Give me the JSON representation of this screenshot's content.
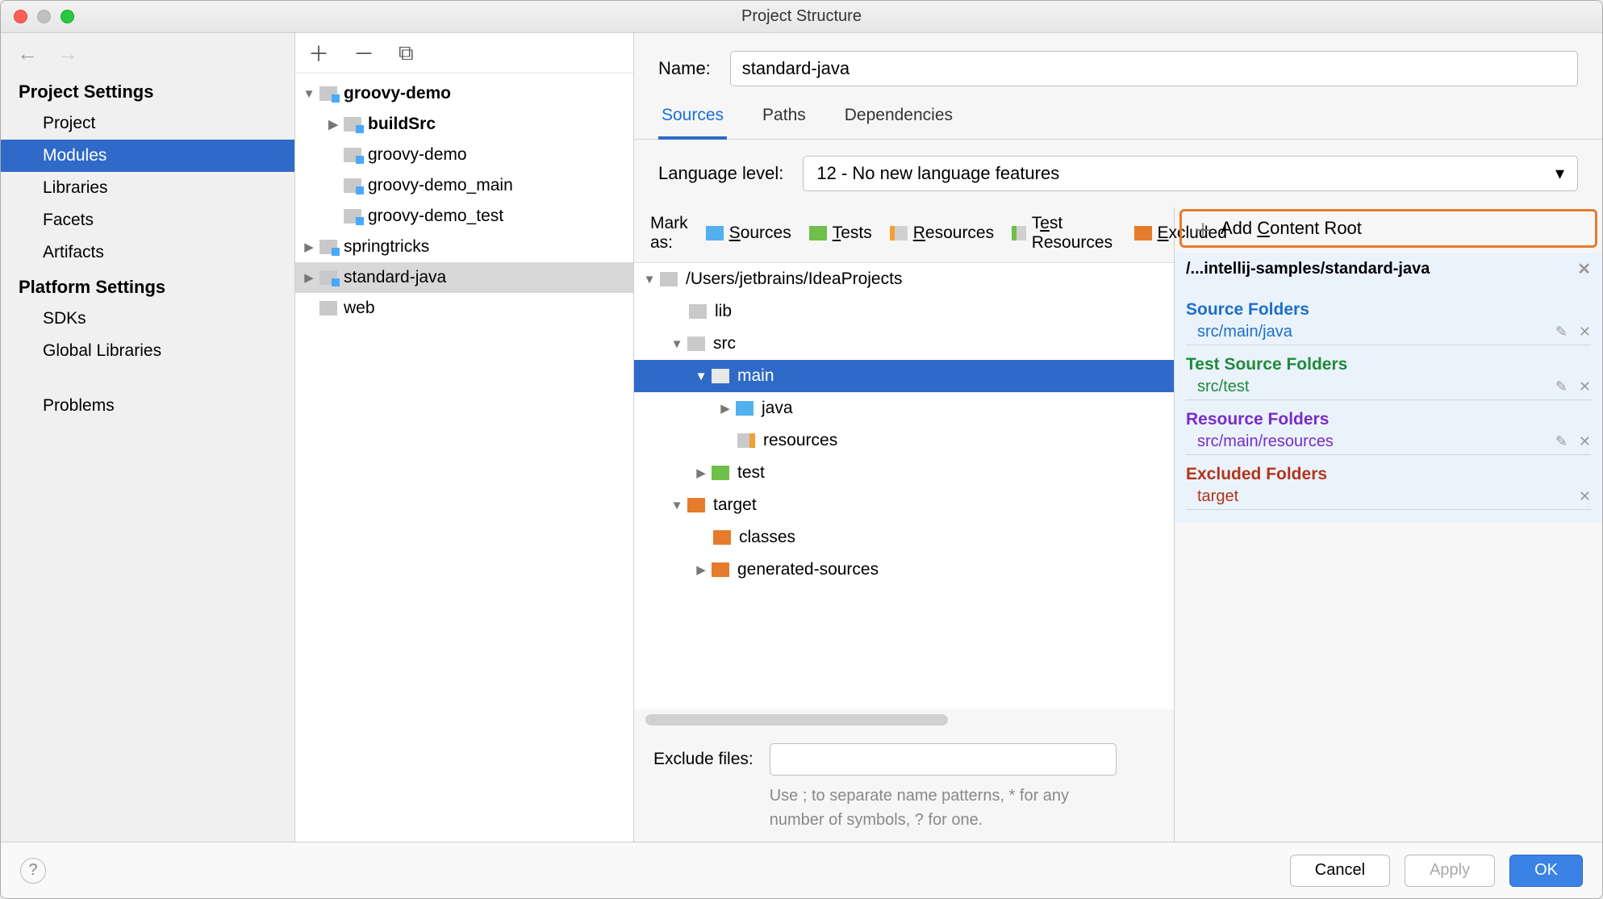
{
  "window": {
    "title": "Project Structure"
  },
  "sidebar": {
    "sections": {
      "project_settings": "Project Settings",
      "platform_settings": "Platform Settings"
    },
    "items": {
      "project": "Project",
      "modules": "Modules",
      "libraries": "Libraries",
      "facets": "Facets",
      "artifacts": "Artifacts",
      "sdks": "SDKs",
      "global_libraries": "Global Libraries",
      "problems": "Problems"
    }
  },
  "module_tree": {
    "groovy_demo": "groovy-demo",
    "buildSrc": "buildSrc",
    "groovy_demo_mod": "groovy-demo",
    "groovy_demo_main": "groovy-demo_main",
    "groovy_demo_test": "groovy-demo_test",
    "springtricks": "springtricks",
    "standard_java": "standard-java",
    "web": "web"
  },
  "main": {
    "name_label": "Name:",
    "name_value": "standard-java",
    "tabs": {
      "sources": "Sources",
      "paths": "Paths",
      "dependencies": "Dependencies"
    },
    "lang_label": "Language level:",
    "lang_value": "12 - No new language features",
    "markas_label": "Mark as:",
    "marks": {
      "sources": "Sources",
      "tests": "Tests",
      "resources": "Resources",
      "test_resources": "Test Resources",
      "excluded": "Excluded"
    },
    "src_tree": {
      "root": "/Users/jetbrains/IdeaProjects",
      "lib": "lib",
      "src": "src",
      "main": "main",
      "java": "java",
      "resources": "resources",
      "test": "test",
      "target": "target",
      "classes": "classes",
      "generated_sources": "generated-sources"
    },
    "exclude_label": "Exclude files:",
    "exclude_hint": "Use ; to separate name patterns, * for any number of symbols, ? for one."
  },
  "right": {
    "add_content_root": "Add Content Root",
    "root_path": "/...intellij-samples/standard-java",
    "groups": {
      "source": {
        "title": "Source Folders",
        "item": "src/main/java"
      },
      "test_source": {
        "title": "Test Source Folders",
        "item": "src/test"
      },
      "resource": {
        "title": "Resource Folders",
        "item": "src/main/resources"
      },
      "excluded": {
        "title": "Excluded Folders",
        "item": "target"
      }
    }
  },
  "footer": {
    "cancel": "Cancel",
    "apply": "Apply",
    "ok": "OK"
  }
}
